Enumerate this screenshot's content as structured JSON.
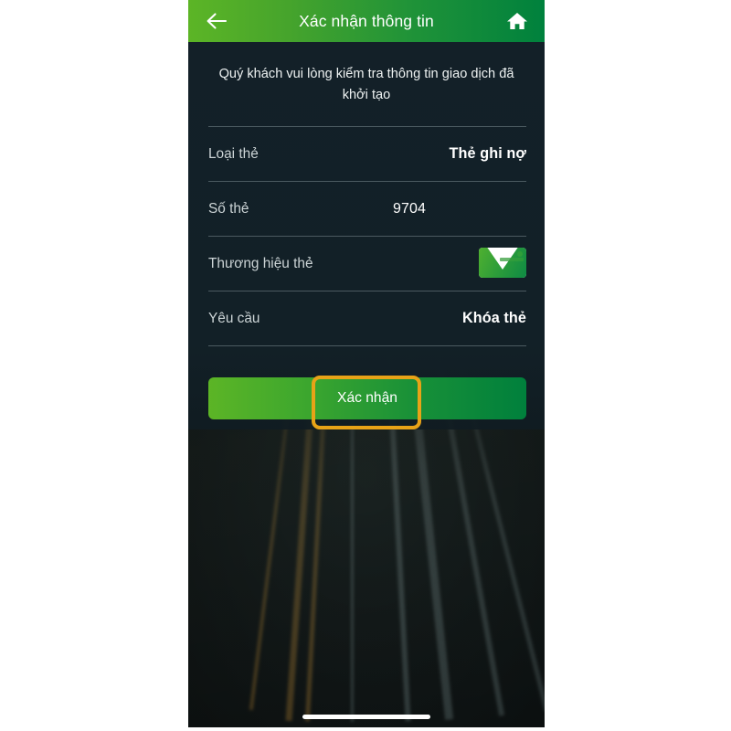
{
  "header": {
    "title": "Xác nhận thông tin",
    "back_icon": "back-arrow-icon",
    "home_icon": "home-icon",
    "gradient_from": "#5cb526",
    "gradient_to": "#00813d"
  },
  "instruction": "Quý khách vui lòng kiểm tra thông tin giao dịch đã khởi tạo",
  "info_rows": [
    {
      "label": "Loại thẻ",
      "value": "Thẻ ghi nợ",
      "type": "text"
    },
    {
      "label": "Số thẻ",
      "value": "9704",
      "type": "text-centered"
    },
    {
      "label": "Thương hiệu thẻ",
      "value": "",
      "type": "card-brand-logo"
    },
    {
      "label": "Yêu cầu",
      "value": "Khóa thẻ",
      "type": "text"
    }
  ],
  "confirm_button": {
    "label": "Xác nhận",
    "gradient_from": "#5cb526",
    "gradient_to": "#00803c"
  },
  "annotation": {
    "color": "#e8a317",
    "target": "confirm-button"
  },
  "colors": {
    "screen_background": "#0f1c22",
    "content_background": "#132028",
    "divider": "#56656b",
    "label_text": "#ccd4d6",
    "value_text": "#ffffff"
  }
}
